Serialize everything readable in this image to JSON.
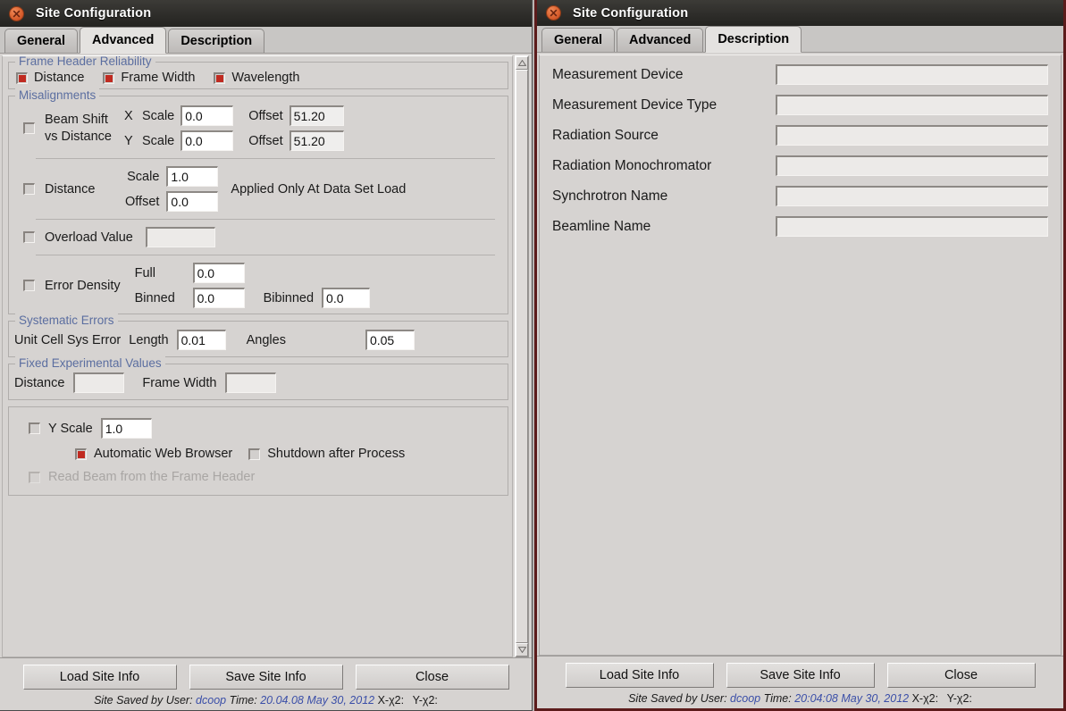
{
  "windows": {
    "left": {
      "title": "Site Configuration",
      "tabs": [
        {
          "label": "General",
          "selected": false
        },
        {
          "label": "Advanced",
          "selected": true
        },
        {
          "label": "Description",
          "selected": false
        }
      ],
      "advanced": {
        "frame_header_reliability": {
          "legend": "Frame Header Reliability",
          "checkboxes": [
            {
              "label": "Distance",
              "checked": true
            },
            {
              "label": "Frame Width",
              "checked": true
            },
            {
              "label": "Wavelength",
              "checked": true
            }
          ]
        },
        "misalignments": {
          "legend": "Misalignments",
          "beam_shift": {
            "checked": false,
            "label_line1": "Beam Shift",
            "label_line2": "vs Distance",
            "x_axis": "X",
            "y_axis": "Y",
            "scale_label": "Scale",
            "offset_label": "Offset",
            "x_scale": "0.0",
            "x_offset": "51.20",
            "y_scale": "0.0",
            "y_offset": "51.20"
          },
          "distance": {
            "checked": false,
            "label": "Distance",
            "scale_label": "Scale",
            "offset_label": "Offset",
            "scale": "1.0",
            "offset": "0.0",
            "note": "Applied Only At Data Set Load"
          },
          "overload": {
            "checked": false,
            "label": "Overload Value",
            "value": ""
          },
          "error_density": {
            "checked": false,
            "label": "Error Density",
            "full_label": "Full",
            "full": "0.0",
            "binned_label": "Binned",
            "binned": "0.0",
            "bibinned_label": "Bibinned",
            "bibinned": "0.0"
          }
        },
        "systematic_errors": {
          "legend": "Systematic Errors",
          "unit_cell_label": "Unit Cell Sys Error",
          "length_label": "Length",
          "length": "0.01",
          "angles_label": "Angles",
          "angles": "0.05"
        },
        "fixed_experimental_values": {
          "legend": "Fixed Experimental Values",
          "distance_label": "Distance",
          "distance": "",
          "frame_width_label": "Frame Width",
          "frame_width": ""
        },
        "misc": {
          "y_scale_label": "Y Scale",
          "y_scale_checked": false,
          "y_scale": "1.0",
          "auto_browser_label": "Automatic Web Browser",
          "auto_browser_checked": true,
          "shutdown_label": "Shutdown after Process",
          "shutdown_checked": false,
          "read_beam_label": "Read Beam from the Frame Header",
          "read_beam_checked": false,
          "read_beam_disabled": true
        }
      },
      "buttons": {
        "load": "Load Site Info",
        "save": "Save Site Info",
        "close": "Close"
      },
      "status": {
        "prefix": "Site Saved by User:",
        "user": "dcoop",
        "time_label": "Time:",
        "time": "20.04.08 May 30, 2012",
        "xchi": "X-χ2:",
        "ychi": "Y-χ2:"
      }
    },
    "right": {
      "title": "Site Configuration",
      "tabs": [
        {
          "label": "General",
          "selected": false
        },
        {
          "label": "Advanced",
          "selected": false
        },
        {
          "label": "Description",
          "selected": true
        }
      ],
      "description": {
        "fields": [
          {
            "label": "Measurement Device",
            "value": ""
          },
          {
            "label": "Measurement Device Type",
            "value": ""
          },
          {
            "label": "Radiation Source",
            "value": ""
          },
          {
            "label": "Radiation Monochromator",
            "value": ""
          },
          {
            "label": "Synchrotron Name",
            "value": ""
          },
          {
            "label": "Beamline Name",
            "value": ""
          }
        ]
      },
      "buttons": {
        "load": "Load Site Info",
        "save": "Save Site Info",
        "close": "Close"
      },
      "status": {
        "prefix": "Site Saved by User:",
        "user": "dcoop",
        "time_label": "Time:",
        "time": "20:04:08 May 30, 2012",
        "xchi": "X-χ2:",
        "ychi": "Y-χ2:"
      }
    }
  },
  "colors": {
    "accent_checked": "#c02a20",
    "legend_text": "#5b6ea0",
    "status_value": "#3b4fa8",
    "active_window_border": "#5c1b1b"
  },
  "icons": {
    "close": "close-icon",
    "scroll_up": "chevron-up-icon",
    "scroll_down": "chevron-down-icon"
  }
}
